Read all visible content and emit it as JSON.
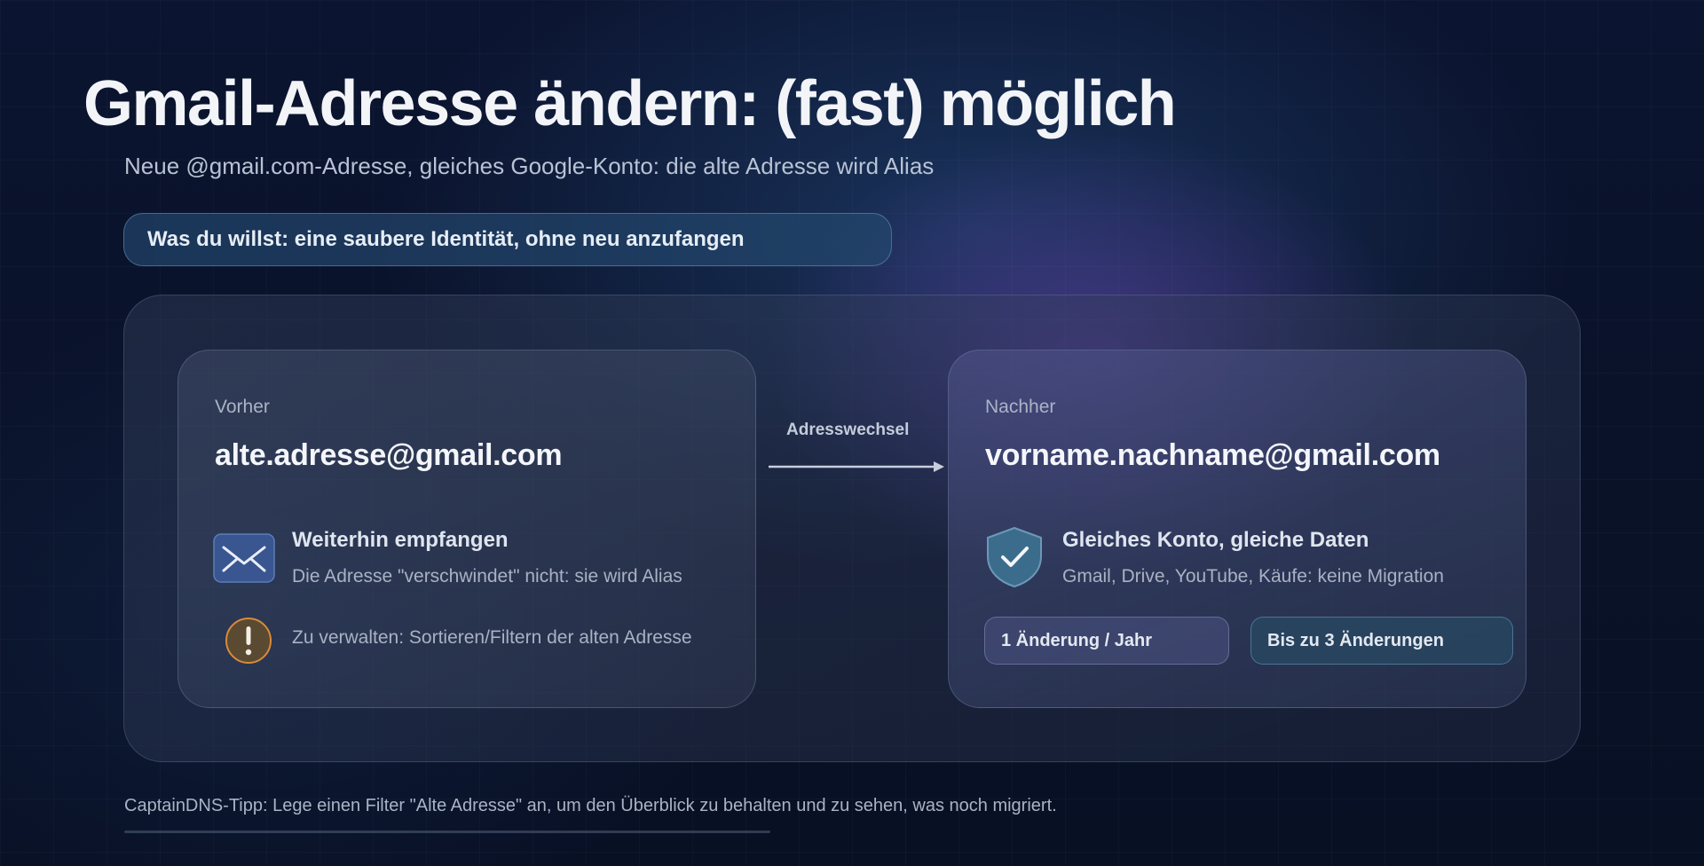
{
  "title": "Gmail-Adresse ändern: (fast) möglich",
  "subtitle": "Neue @gmail.com-Adresse, gleiches Google-Konto: die alte Adresse wird Alias",
  "goal": "Was du willst: eine saubere Identität, ohne neu anzufangen",
  "before": {
    "label": "Vorher",
    "email": "alte.adresse@gmail.com",
    "feature_icon": "envelope-icon",
    "feature_title": "Weiterhin empfangen",
    "feature_desc": "Die Adresse \"verschwindet\" nicht: sie wird Alias",
    "warning_icon": "exclamation-icon",
    "warning_text": "Zu verwalten: Sortieren/Filtern der alten Adresse"
  },
  "transition": {
    "label": "Adresswechsel",
    "icon": "arrow-right-icon"
  },
  "after": {
    "label": "Nachher",
    "email": "vorname.nachname@gmail.com",
    "feature_icon": "shield-check-icon",
    "feature_title": "Gleiches Konto, gleiche Daten",
    "feature_desc": "Gmail, Drive, YouTube, Käufe: keine Migration",
    "badges": [
      "1 Änderung / Jahr",
      "Bis zu 3 Änderungen"
    ]
  },
  "tip": "CaptainDNS-Tipp: Lege einen Filter \"Alte Adresse\" an, um den Überblick zu behalten und zu sehen, was noch migriert.",
  "colors": {
    "background": "#0b1430",
    "accent_purple": "#6a42b0",
    "warning_orange": "#d98a3a",
    "envelope_blue": "#3a5690",
    "shield_teal": "#3c6c8c"
  }
}
